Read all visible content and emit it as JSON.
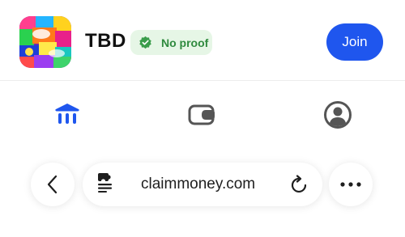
{
  "header": {
    "app_title": "TBD",
    "app_icon": "candy-collage-app-icon",
    "badge": {
      "label": "No proof",
      "icon": "check-badge-icon",
      "color": "#2f8a3e"
    },
    "join_label": "Join",
    "accent": "#1f56ee"
  },
  "nav": {
    "items": [
      {
        "icon": "bank-icon",
        "active": true,
        "color": "#1f56ee"
      },
      {
        "icon": "wallet-icon",
        "active": false,
        "color": "#555555"
      },
      {
        "icon": "profile-icon",
        "active": false,
        "color": "#555555"
      }
    ]
  },
  "browser": {
    "url": "claimmoney.com",
    "back_icon": "chevron-left-icon",
    "page_icon": "puzzle-document-icon",
    "reload_icon": "reload-icon",
    "more_icon": "more-icon"
  }
}
